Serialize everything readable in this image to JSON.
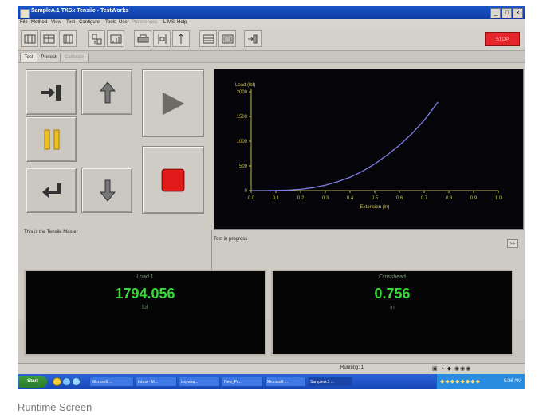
{
  "window": {
    "title": "SampleA.1 TXSx Tensile - TestWorks",
    "buttons": [
      "_",
      "□",
      "×"
    ]
  },
  "menu": [
    "File",
    "Method",
    "View",
    "Test",
    "Configure",
    "Tools",
    "User",
    "Preferences",
    "LIMS",
    "Help"
  ],
  "toolbar": {
    "icons": [
      "method-icon",
      "sample-icon",
      "specimen-icon",
      "report-icon",
      "print-icon",
      "calibrate-icon",
      "crosshead-icon",
      "monitor-icon",
      "display-icon",
      "exit-icon"
    ],
    "stop_label": "STOP",
    "stop_color": "#e5262c"
  },
  "tabs": [
    "Test",
    "Pretest",
    "Calibrate"
  ],
  "controls": {
    "icons": [
      "load-specimen-icon",
      "jog-up-icon",
      "run-test-icon",
      "pause-icon",
      "stop-test-icon",
      "return-icon",
      "jog-down-icon"
    ]
  },
  "plot": {
    "ylabel": "Load (lbf)",
    "xlabel": "Extension (in)",
    "yticks": [
      "2000",
      "1500",
      "1000",
      "500",
      "0"
    ],
    "xticks": [
      "0.0",
      "0.1",
      "0.2",
      "0.3",
      "0.4",
      "0.5",
      "0.6",
      "0.7",
      "0.8",
      "0.9",
      "1.0"
    ]
  },
  "chart_data": {
    "type": "line",
    "xlabel": "Extension (in)",
    "ylabel": "Load (lbf)",
    "xlim": [
      0,
      1.0
    ],
    "ylim": [
      0,
      2000
    ],
    "grid": false,
    "series": [
      {
        "x": [
          0,
          0.05,
          0.1,
          0.15,
          0.2,
          0.25,
          0.3,
          0.35,
          0.4,
          0.45,
          0.5,
          0.55,
          0.6,
          0.65,
          0.7,
          0.756
        ],
        "values": [
          0,
          0,
          3,
          10,
          25,
          60,
          110,
          180,
          270,
          390,
          540,
          720,
          920,
          1150,
          1420,
          1794
        ]
      }
    ],
    "line_color": "#7f7fe8"
  },
  "info": {
    "left_text": "This is the Tensile Master",
    "right_text": "Test in progress",
    "expand_btn": ">>"
  },
  "readouts": [
    {
      "label": "Load 1",
      "value": "1794.056",
      "unit": "lbf"
    },
    {
      "label": "Crosshead",
      "value": "0.756",
      "unit": "in"
    }
  ],
  "status": {
    "running": "Running: 1",
    "icons": "▣ ◔ ◆ ◉◉◉"
  },
  "taskbar": {
    "start": "Start",
    "tasks": [
      "Microsoft ...",
      "Inbox - M...",
      "tzq-wsq...",
      "New_Pr...",
      "Microsoft ...",
      "SampleA.1 ..."
    ],
    "tray_icons": "◆◆◆◆◆◆◆◆",
    "clock": "9:36 AM"
  },
  "caption": "Runtime Screen"
}
